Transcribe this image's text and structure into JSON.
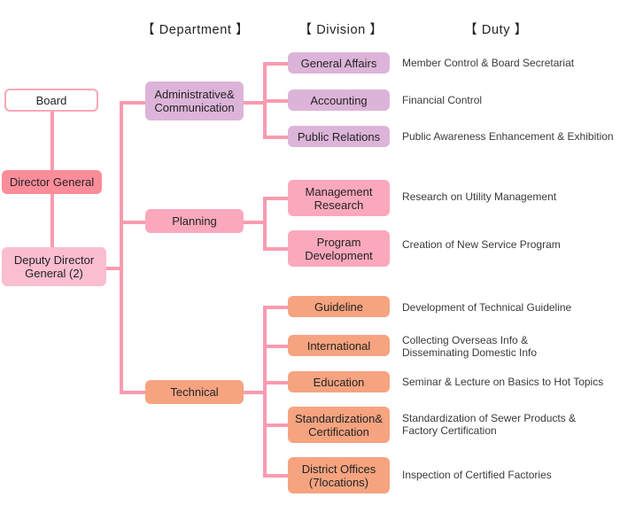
{
  "headers": {
    "department": "【 Department 】",
    "division": "【 Division 】",
    "duty": "【 Duty 】"
  },
  "colors": {
    "line": "#f99bb0",
    "board_border": "#f9a7b8",
    "director_general": "#fb8d99",
    "deputy_director": "#fbbdd0",
    "administrative": "#ddb4d9",
    "planning": "#fba8bd",
    "technical": "#f6a380",
    "text": "#232323"
  },
  "hierarchy": {
    "board": "Board",
    "director_general": "Director General",
    "deputy_director_general": "Deputy Director\nGeneral (2)"
  },
  "departments": [
    {
      "id": "administrative-communication",
      "label": "Administrative&\nCommunication",
      "divisions": [
        {
          "label": "General Affairs",
          "duty": "Member Control & Board Secretariat"
        },
        {
          "label": "Accounting",
          "duty": "Financial Control"
        },
        {
          "label": "Public Relations",
          "duty": "Public Awareness Enhancement & Exhibition"
        }
      ]
    },
    {
      "id": "planning",
      "label": "Planning",
      "divisions": [
        {
          "label": "Management\nResearch",
          "duty": "Research on Utility Management"
        },
        {
          "label": "Program\nDevelopment",
          "duty": "Creation of New Service Program"
        }
      ]
    },
    {
      "id": "technical",
      "label": "Technical",
      "divisions": [
        {
          "label": "Guideline",
          "duty": "Development of Technical Guideline"
        },
        {
          "label": "International",
          "duty": "Collecting Overseas Info &\nDisseminating Domestic Info"
        },
        {
          "label": "Education",
          "duty": "Seminar & Lecture on Basics to Hot Topics"
        },
        {
          "label": "Standardization&\nCertification",
          "duty": "Standardization of Sewer Products &\nFactory Certification"
        },
        {
          "label": "District Offices\n(7locations)",
          "duty": "Inspection of Certified Factories"
        }
      ]
    }
  ]
}
